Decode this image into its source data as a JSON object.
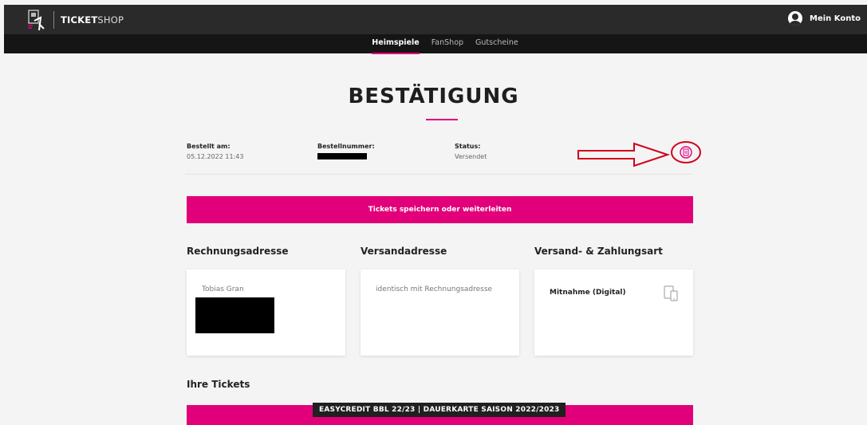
{
  "header": {
    "brand_bold": "TICKET",
    "brand_light": "SHOP",
    "account_label": "Mein Konto"
  },
  "nav": {
    "items": [
      {
        "label": "Heimspiele",
        "active": true
      },
      {
        "label": "FanShop",
        "active": false
      },
      {
        "label": "Gutscheine",
        "active": false
      }
    ]
  },
  "page": {
    "title": "BESTÄTIGUNG"
  },
  "order": {
    "ordered_label": "Bestellt am:",
    "ordered_value": "05.12.2022 11:43",
    "number_label": "Bestellnummer:",
    "status_label": "Status:",
    "status_value": "Versendet"
  },
  "actions": {
    "save_tickets": "Tickets speichern oder weiterleiten"
  },
  "sections": {
    "billing_title": "Rechnungsadresse",
    "billing_name": "Tobias Gran",
    "shipping_title": "Versandadresse",
    "shipping_text": "identisch mit Rechnungsadresse",
    "method_title": "Versand- & Zahlungsart",
    "method_value": "Mitnahme (Digital)"
  },
  "tickets": {
    "heading": "Ihre Tickets",
    "item_title": "EASYCREDIT BBL 22/23 | DAUERKARTE SAISON 2022/2023"
  },
  "colors": {
    "accent": "#e2007a",
    "header_bg": "#2a2a2a",
    "annotation_red": "#d0021b"
  },
  "icons": [
    "logo-icon",
    "user-icon",
    "pdf-download-icon",
    "device-icon",
    "arrow-annotation-icon"
  ]
}
